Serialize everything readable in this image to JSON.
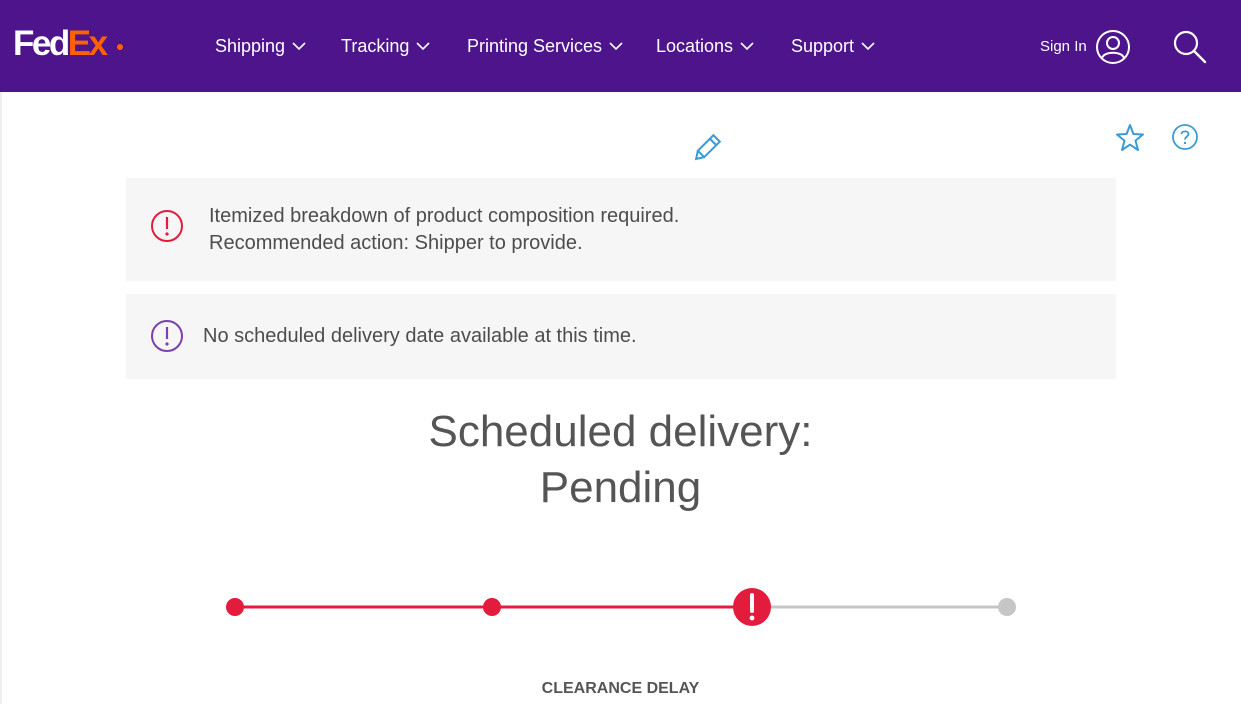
{
  "header": {
    "logo_fed": "Fed",
    "logo_ex": "Ex",
    "nav": [
      {
        "label": "Shipping"
      },
      {
        "label": "Tracking"
      },
      {
        "label": "Printing Services"
      },
      {
        "label": "Locations"
      },
      {
        "label": "Support"
      }
    ],
    "sign_in": "Sign In"
  },
  "alerts": [
    {
      "line1": "Itemized breakdown of product composition required.",
      "line2": "Recommended action: Shipper to provide.",
      "color": "#e31c3d"
    },
    {
      "line1": "No scheduled delivery date available at this time.",
      "color": "#7b3fb0"
    }
  ],
  "delivery": {
    "label": "Scheduled delivery:",
    "value": "Pending"
  },
  "progress": {
    "steps_total": 4,
    "current_step": 3,
    "current_state": "exception",
    "status_label": "CLEARANCE DELAY"
  },
  "colors": {
    "brand_purple": "#4d148c",
    "brand_orange": "#ff6200",
    "alert_red": "#e31c3d",
    "icon_blue": "#3a9bd5",
    "inactive_gray": "#c6c6c6"
  }
}
